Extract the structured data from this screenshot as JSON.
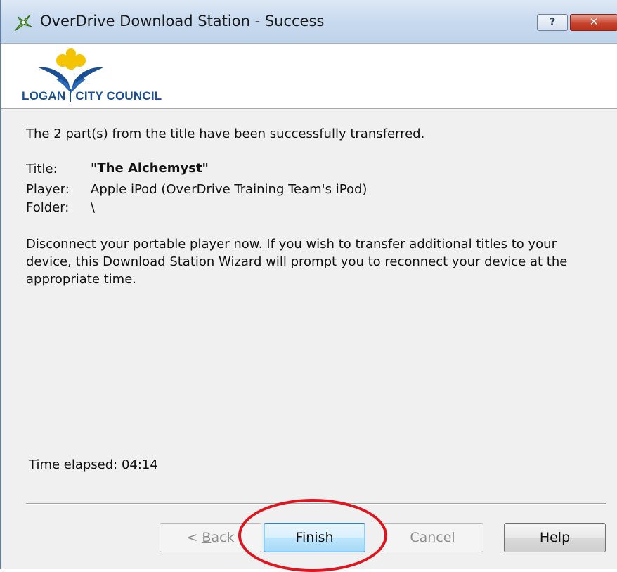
{
  "window": {
    "title": "OverDrive Download Station - Success",
    "help_button": "?",
    "close_button": "✕"
  },
  "logo": {
    "left_text": "LOGAN",
    "right_text": "CITY COUNCIL",
    "color": "#1a4f94",
    "accent": "#f5c400"
  },
  "content": {
    "status_message": "The 2 part(s) from the title have been successfully transferred.",
    "details": {
      "title_label": "Title:",
      "title_value": "\"The Alchemyst\"",
      "player_label": "Player:",
      "player_value": "Apple iPod (OverDrive Training Team's iPod)",
      "folder_label": "Folder:",
      "folder_value": "\\"
    },
    "instructions": "Disconnect your portable player now. If you wish to transfer additional titles to your device, this Download Station Wizard will prompt you to reconnect your device at the appropriate time.",
    "time_elapsed": "Time elapsed: 04:14"
  },
  "buttons": {
    "back_prefix": "< ",
    "back_underlined": "B",
    "back_rest": "ack",
    "finish": "Finish",
    "cancel": "Cancel",
    "help": "Help"
  },
  "annotation": {
    "ring_color": "#e0141e"
  }
}
